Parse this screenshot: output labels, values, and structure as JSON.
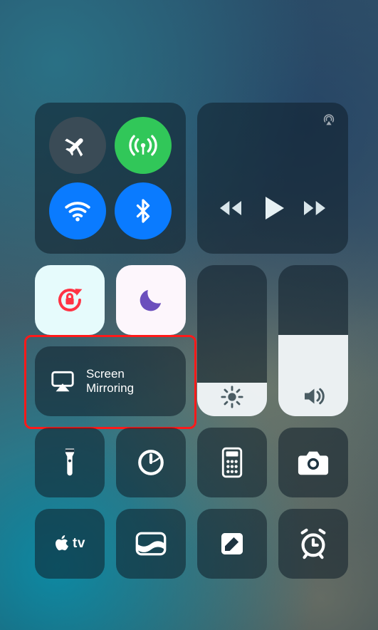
{
  "connectivity": {
    "airplane": {
      "name": "airplane-icon",
      "active": false
    },
    "cellular": {
      "name": "cellular-icon",
      "active": true,
      "color": "#31c759"
    },
    "wifi": {
      "name": "wifi-icon",
      "active": true,
      "color": "#0a7bff"
    },
    "bluetooth": {
      "name": "bluetooth-icon",
      "active": true,
      "color": "#0a7bff"
    }
  },
  "media": {
    "airplay_hint": "airplay-audio-icon",
    "controls": {
      "rewind": "rewind-icon",
      "play": "play-icon",
      "forward": "forward-icon"
    }
  },
  "toggles": {
    "rotation_lock": {
      "name": "rotation-lock-icon",
      "active": true,
      "bg": "#e6fbfc",
      "tint": "#ff3344"
    },
    "dnd": {
      "name": "do-not-disturb-icon",
      "active": false,
      "bg": "#fdf6fc",
      "tint": "#6b4fbd"
    }
  },
  "screen_mirroring": {
    "icon": "airplay-video-icon",
    "label_line1": "Screen",
    "label_line2": "Mirroring"
  },
  "sliders": {
    "brightness": {
      "icon": "brightness-icon",
      "value_percent": 22
    },
    "volume": {
      "icon": "volume-icon",
      "value_percent": 54
    }
  },
  "shortcuts": {
    "row1": [
      {
        "name": "flashlight-icon"
      },
      {
        "name": "timer-icon"
      },
      {
        "name": "calculator-icon"
      },
      {
        "name": "camera-icon"
      }
    ],
    "row2": [
      {
        "name": "apple-tv-icon",
        "label": "tv"
      },
      {
        "name": "wallet-icon"
      },
      {
        "name": "notes-icon"
      },
      {
        "name": "alarm-icon"
      }
    ]
  },
  "colors": {
    "panel": "rgba(15,30,40,0.55)",
    "white": "#ffffff",
    "lightTile": "#e9fbfc"
  }
}
